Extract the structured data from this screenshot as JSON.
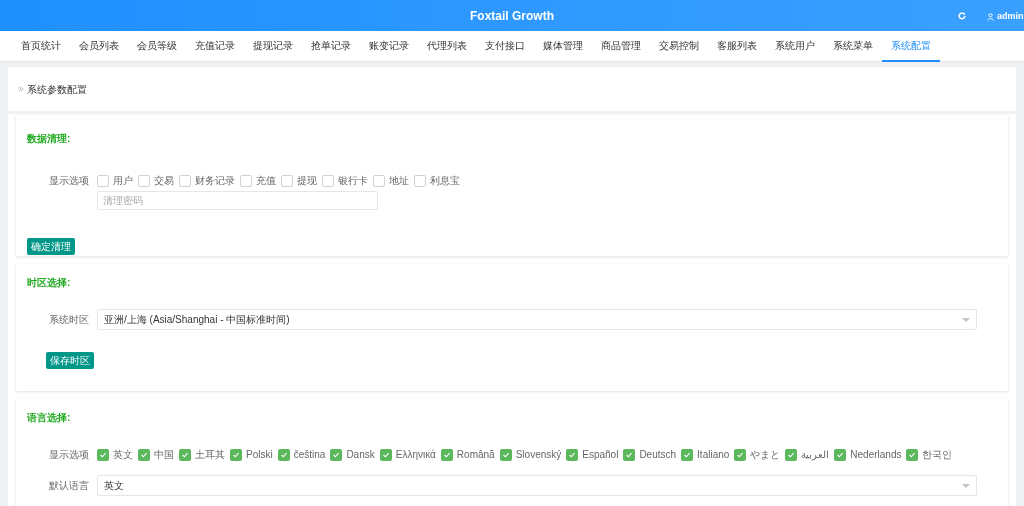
{
  "header": {
    "title": "Foxtail Growth",
    "user": "admin"
  },
  "nav": [
    {
      "label": "首页统计",
      "selected": false
    },
    {
      "label": "会员列表",
      "selected": false
    },
    {
      "label": "会员等级",
      "selected": false
    },
    {
      "label": "充值记录",
      "selected": false
    },
    {
      "label": "提现记录",
      "selected": false
    },
    {
      "label": "抢单记录",
      "selected": false
    },
    {
      "label": "账变记录",
      "selected": false
    },
    {
      "label": "代理列表",
      "selected": false
    },
    {
      "label": "支付接口",
      "selected": false
    },
    {
      "label": "媒体管理",
      "selected": false
    },
    {
      "label": "商品管理",
      "selected": false
    },
    {
      "label": "交易控制",
      "selected": false
    },
    {
      "label": "客服列表",
      "selected": false
    },
    {
      "label": "系统用户",
      "selected": false
    },
    {
      "label": "系统菜单",
      "selected": false
    },
    {
      "label": "系统配置",
      "selected": true
    }
  ],
  "breadcrumb": "系统参数配置",
  "data_cleanup": {
    "title": "数据清理:",
    "label": "显示选项",
    "options": [
      {
        "label": "用户",
        "checked": false
      },
      {
        "label": "交易",
        "checked": false
      },
      {
        "label": "财务记录",
        "checked": false
      },
      {
        "label": "充值",
        "checked": false
      },
      {
        "label": "提现",
        "checked": false
      },
      {
        "label": "银行卡",
        "checked": false
      },
      {
        "label": "地址",
        "checked": false
      },
      {
        "label": "利息宝",
        "checked": false
      }
    ],
    "password_placeholder": "清理密码",
    "button": "确定清理"
  },
  "timezone": {
    "title": "时区选择:",
    "label": "系统时区",
    "value": "亚洲/上海 (Asia/Shanghai - 中国标准时间)",
    "button": "保存时区"
  },
  "language": {
    "title": "语言选择:",
    "label": "显示选项",
    "options": [
      {
        "label": "英文",
        "checked": true
      },
      {
        "label": "中国",
        "checked": true
      },
      {
        "label": "土耳其",
        "checked": true
      },
      {
        "label": "Polski",
        "checked": true
      },
      {
        "label": "čeština",
        "checked": true
      },
      {
        "label": "Dansk",
        "checked": true
      },
      {
        "label": "Ελληνικά",
        "checked": true
      },
      {
        "label": "Română",
        "checked": true
      },
      {
        "label": "Slovenský",
        "checked": true
      },
      {
        "label": "Español",
        "checked": true
      },
      {
        "label": "Deutsch",
        "checked": true
      },
      {
        "label": "Italiano",
        "checked": true
      },
      {
        "label": "やまと",
        "checked": true
      },
      {
        "label": "العربية",
        "checked": true
      },
      {
        "label": "Nederlands",
        "checked": true
      },
      {
        "label": "한국인",
        "checked": true
      }
    ],
    "default_label": "默认语言",
    "default_value": "英文"
  }
}
